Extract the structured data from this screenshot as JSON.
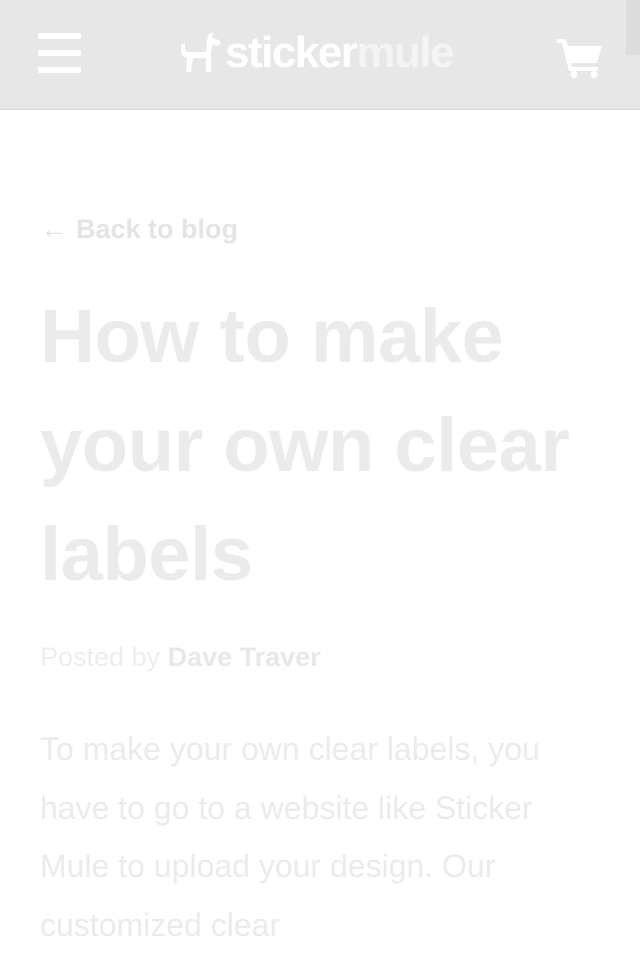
{
  "header": {
    "logo_text_a": "sticker",
    "logo_text_b": "mule",
    "menu_icon": "hamburger-menu-icon",
    "cart_icon": "shopping-cart-icon",
    "background": "#e7e7e7"
  },
  "nav": {
    "back_arrow": "←",
    "back_label": "Back to blog"
  },
  "article": {
    "title": "How to make your own clear labels",
    "byline_prefix": "Posted by",
    "author": "Dave Traver",
    "body": "To make your own clear labels, you have to go to a website like Sticker Mule to upload your design. Our customized clear"
  }
}
